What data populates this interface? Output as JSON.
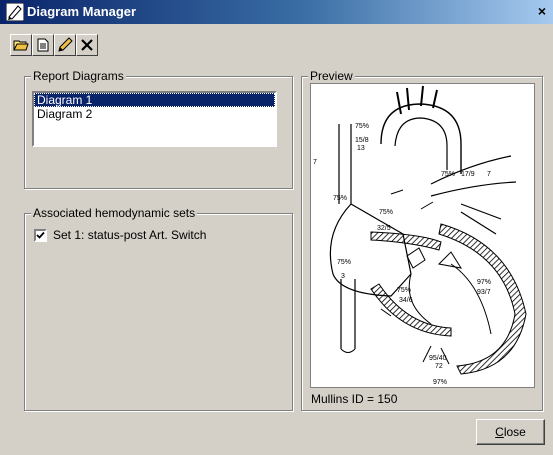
{
  "window": {
    "title": "Diagram Manager",
    "close_glyph": "×"
  },
  "toolbar": {
    "buttons": [
      {
        "icon": "open-folder-icon"
      },
      {
        "icon": "document-icon"
      },
      {
        "icon": "pencil-icon"
      },
      {
        "icon": "delete-x-icon"
      }
    ]
  },
  "report_diagrams": {
    "label": "Report Diagrams",
    "items": [
      "Diagram 1",
      "Diagram 2"
    ],
    "selected_index": 0
  },
  "hemodynamic": {
    "label": "Associated hemodynamic sets",
    "sets": [
      {
        "label": "Set 1: status-post Art. Switch",
        "checked": true
      }
    ]
  },
  "preview": {
    "label": "Preview",
    "annotations": {
      "svc_sat": "75%",
      "svc_pressure_a": "15/8",
      "svc_pressure_b": "13",
      "left_7": "7",
      "top_right_sat": "75%",
      "top_right_pressure": "17/9",
      "right_7": "7",
      "rv_sat": "75%",
      "la_sat": "75%",
      "la_pressure": "32/5",
      "ra_sat": "75%",
      "ra_pressure": "3",
      "lv_sat": "97%",
      "lv_pressure": "93/7",
      "rv_mid_sat": "75%",
      "rv_mid_pressure": "34/6",
      "ao_pressure": "95/40",
      "ao_mean": "72",
      "ao_sat": "97%"
    },
    "mullins_id": "Mullins ID = 150"
  },
  "close_button": {
    "label_first": "C",
    "label_rest": "lose"
  },
  "colors": {
    "title_start": "#0a246a",
    "title_end": "#a6caf0",
    "selection": "#0a246a",
    "face": "#d4d0c8"
  }
}
